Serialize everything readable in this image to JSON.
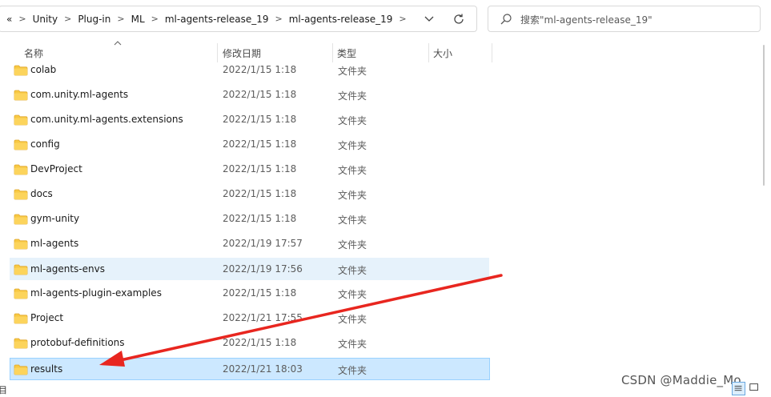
{
  "address_bar": {
    "overflow": "«",
    "crumbs": [
      "Unity",
      "Plug-in",
      "ML",
      "ml-agents-release_19",
      "ml-agents-release_19"
    ]
  },
  "search": {
    "placeholder": "搜索\"ml-agents-release_19\""
  },
  "columns": {
    "name": "名称",
    "date": "修改日期",
    "type": "类型",
    "size": "大小"
  },
  "files": [
    {
      "name": "colab",
      "date": "2022/1/15 1:18",
      "type": "文件夹"
    },
    {
      "name": "com.unity.ml-agents",
      "date": "2022/1/15 1:18",
      "type": "文件夹"
    },
    {
      "name": "com.unity.ml-agents.extensions",
      "date": "2022/1/15 1:18",
      "type": "文件夹"
    },
    {
      "name": "config",
      "date": "2022/1/15 1:18",
      "type": "文件夹"
    },
    {
      "name": "DevProject",
      "date": "2022/1/15 1:18",
      "type": "文件夹"
    },
    {
      "name": "docs",
      "date": "2022/1/15 1:18",
      "type": "文件夹"
    },
    {
      "name": "gym-unity",
      "date": "2022/1/15 1:18",
      "type": "文件夹"
    },
    {
      "name": "ml-agents",
      "date": "2022/1/19 17:57",
      "type": "文件夹"
    },
    {
      "name": "ml-agents-envs",
      "date": "2022/1/19 17:56",
      "type": "文件夹"
    },
    {
      "name": "ml-agents-plugin-examples",
      "date": "2022/1/15 1:18",
      "type": "文件夹"
    },
    {
      "name": "Project",
      "date": "2022/1/21 17:55",
      "type": "文件夹"
    },
    {
      "name": "protobuf-definitions",
      "date": "2022/1/15 1:18",
      "type": "文件夹"
    },
    {
      "name": "results",
      "date": "2022/1/21 18:03",
      "type": "文件夹"
    }
  ],
  "states": {
    "hovered_row": "ml-agents-envs",
    "selected_row": "results"
  },
  "colors": {
    "folder": "#f8c943",
    "hover": "#e6f2fb",
    "selected": "#cce8ff",
    "annotation_arrow": "#e8261f"
  },
  "status": {
    "edge": "目"
  },
  "watermark": "CSDN @Maddie_Mo"
}
